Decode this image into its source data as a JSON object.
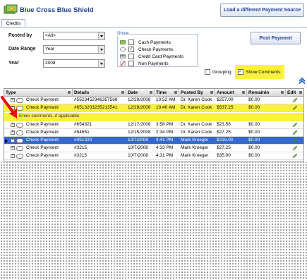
{
  "app": {
    "title": "Blue Cross Blue Shield"
  },
  "toolbar": {
    "load_button": "Load a different Payment Source",
    "post_button": "Post Payment"
  },
  "tabs": [
    {
      "label": "Credits"
    }
  ],
  "filters": {
    "posted_by": {
      "label": "Posted by",
      "value": "<All>"
    },
    "date_range": {
      "label": "Date Range",
      "value": "Year"
    },
    "year": {
      "label": "Year",
      "value": "2008"
    }
  },
  "show_group": {
    "legend": "Show",
    "options": [
      {
        "label": "Cash Payments",
        "checked": false,
        "icon": "cash-icon"
      },
      {
        "label": "Check Payments",
        "checked": true,
        "icon": "check-icon"
      },
      {
        "label": "Credit Card Payments",
        "checked": false,
        "icon": "credit-card-icon"
      },
      {
        "label": "Non Payments",
        "checked": false,
        "icon": "non-payment-icon"
      }
    ]
  },
  "view_options": {
    "grouping": {
      "label": "Grouping",
      "checked": false
    },
    "show_comments": {
      "label": "Show Comments",
      "checked": true
    }
  },
  "grid": {
    "columns": [
      "Type",
      "Details",
      "Date",
      "Time",
      "Posted By",
      "Amount",
      "Remainin",
      "Edit"
    ],
    "rows": [
      {
        "type": "Check Payment",
        "details": "#5523452346357568",
        "date": "12/29/2008",
        "time": "10:52 AM",
        "posted_by": "Dr. Karen Cook",
        "amount": "$257.00",
        "remaining": "$0.00"
      },
      {
        "type": "Check Payment",
        "details": "#6513203235213541",
        "date": "12/29/2008",
        "time": "10:40 AM",
        "posted_by": "Dr. Karen Cook",
        "amount": "$537.25",
        "remaining": "$0.00"
      },
      {
        "type": "Check Payment",
        "details": "#654321",
        "date": "12/17/2008",
        "time": "3:58 PM",
        "posted_by": "Dr. Karen Cook",
        "amount": "$23.56",
        "remaining": "$0.00"
      },
      {
        "type": "Check Payment",
        "details": "#94651",
        "date": "12/15/2008",
        "time": "2:34 PM",
        "posted_by": "Dr. Karen Cook",
        "amount": "$27.25",
        "remaining": "$0.00"
      },
      {
        "type": "Check Payment",
        "details": "#351320",
        "date": "10/7/2008",
        "time": "4:41 PM",
        "posted_by": "Mark Kroeger",
        "amount": "$215.00",
        "remaining": "$0.00"
      },
      {
        "type": "Check Payment",
        "details": "#3215",
        "date": "10/7/2008",
        "time": "4:33 PM",
        "posted_by": "Mark Kroeger",
        "amount": "$27.25",
        "remaining": "$0.00"
      },
      {
        "type": "Check Payment",
        "details": "#3215",
        "date": "10/7/2008",
        "time": "4:31 PM",
        "posted_by": "Mark Kroeger",
        "amount": "$35.00",
        "remaining": "$0.00"
      }
    ],
    "comment_placeholder": "Enter comments, if applicable."
  },
  "colors": {
    "title": "#1f3f94",
    "highlight": "#fbf23d",
    "selected": "#3668d0"
  }
}
